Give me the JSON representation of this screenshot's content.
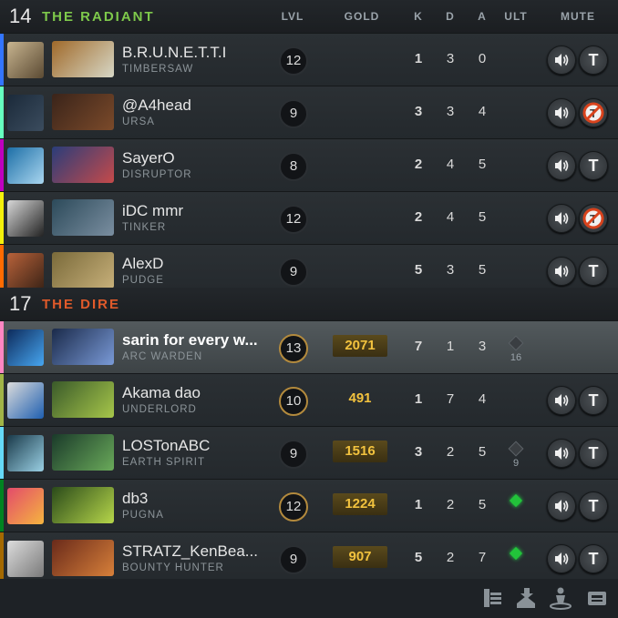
{
  "columns": {
    "lvl": "LVL",
    "gold": "GOLD",
    "k": "K",
    "d": "D",
    "a": "A",
    "ult": "ULT",
    "mute": "MUTE"
  },
  "radiant": {
    "score": "14",
    "name": "THE RADIANT",
    "players": [
      {
        "player": "B.R.U.N.E.T.T.I",
        "hero": "TIMBERSAW",
        "level": "12",
        "gold": "",
        "kills": "1",
        "deaths": "3",
        "assists": "0",
        "ult": "",
        "ult_cd": "",
        "color": "#3375ff",
        "text_chat": "on"
      },
      {
        "player": "@A4head",
        "hero": "URSA",
        "level": "9",
        "gold": "",
        "kills": "3",
        "deaths": "3",
        "assists": "4",
        "ult": "",
        "ult_cd": "",
        "color": "#66ffbf",
        "text_chat": "muted"
      },
      {
        "player": "SayerO",
        "hero": "DISRUPTOR",
        "level": "8",
        "gold": "",
        "kills": "2",
        "deaths": "4",
        "assists": "5",
        "ult": "",
        "ult_cd": "",
        "color": "#bf00bf",
        "text_chat": "on"
      },
      {
        "player": "iDC mmr",
        "hero": "TINKER",
        "level": "12",
        "gold": "",
        "kills": "2",
        "deaths": "4",
        "assists": "5",
        "ult": "",
        "ult_cd": "",
        "color": "#f3f00b",
        "text_chat": "muted"
      },
      {
        "player": "AlexD",
        "hero": "PUDGE",
        "level": "9",
        "gold": "",
        "kills": "5",
        "deaths": "3",
        "assists": "5",
        "ult": "",
        "ult_cd": "",
        "color": "#ff6b00",
        "text_chat": "on"
      }
    ]
  },
  "dire": {
    "score": "17",
    "name": "THE DIRE",
    "players": [
      {
        "player": "sarin for every w...",
        "hero": "ARC WARDEN",
        "level": "13",
        "gold": "2071",
        "kills": "7",
        "deaths": "1",
        "assists": "3",
        "ult": "cooldown",
        "ult_cd": "16",
        "color": "#fe86c2",
        "text_chat": "none"
      },
      {
        "player": "Akama dao",
        "hero": "UNDERLORD",
        "level": "10",
        "gold": "491",
        "kills": "1",
        "deaths": "7",
        "assists": "4",
        "ult": "",
        "ult_cd": "",
        "color": "#a1b447",
        "text_chat": "on"
      },
      {
        "player": "LOSTonABC",
        "hero": "EARTH SPIRIT",
        "level": "9",
        "gold": "1516",
        "kills": "3",
        "deaths": "2",
        "assists": "5",
        "ult": "cooldown",
        "ult_cd": "9",
        "color": "#65d9f7",
        "text_chat": "on"
      },
      {
        "player": "db3",
        "hero": "PUGNA",
        "level": "12",
        "gold": "1224",
        "kills": "1",
        "deaths": "2",
        "assists": "5",
        "ult": "ready",
        "ult_cd": "",
        "color": "#008321",
        "text_chat": "on"
      },
      {
        "player": "STRATZ_KenBea...",
        "hero": "BOUNTY HUNTER",
        "level": "9",
        "gold": "907",
        "kills": "5",
        "deaths": "2",
        "assists": "7",
        "ult": "ready",
        "ult_cd": "",
        "color": "#a46900",
        "text_chat": "on"
      }
    ]
  },
  "footer_icons": [
    "items-list-icon",
    "ability-upgrade-icon",
    "tp-scroll-icon",
    "camera-icon"
  ],
  "text_mute_letter": "T",
  "colors": {
    "radiant": "#7ec94b",
    "dire": "#e05a2a",
    "gold": "#f2c23e"
  }
}
